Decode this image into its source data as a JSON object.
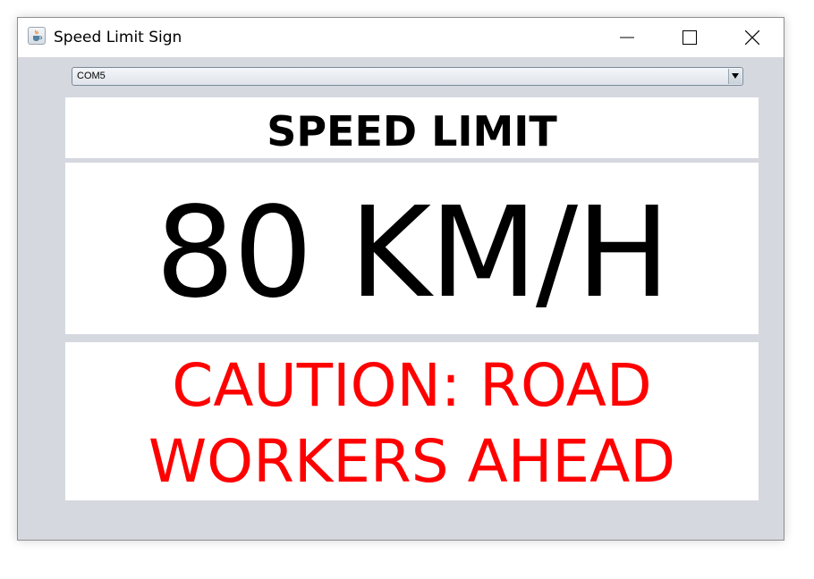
{
  "window": {
    "title": "Speed Limit Sign",
    "icon": "java-cup-icon"
  },
  "port_selector": {
    "selected": "COM5"
  },
  "sign": {
    "heading": "SPEED LIMIT",
    "speed": "80 KM/H",
    "caution_line1": "CAUTION: ROAD",
    "caution_line2": "WORKERS AHEAD"
  },
  "colors": {
    "window_background": "#d5d8df",
    "panel_background": "#ffffff",
    "heading_color": "#000000",
    "speed_color": "#000000",
    "caution_color": "#ff0000"
  }
}
